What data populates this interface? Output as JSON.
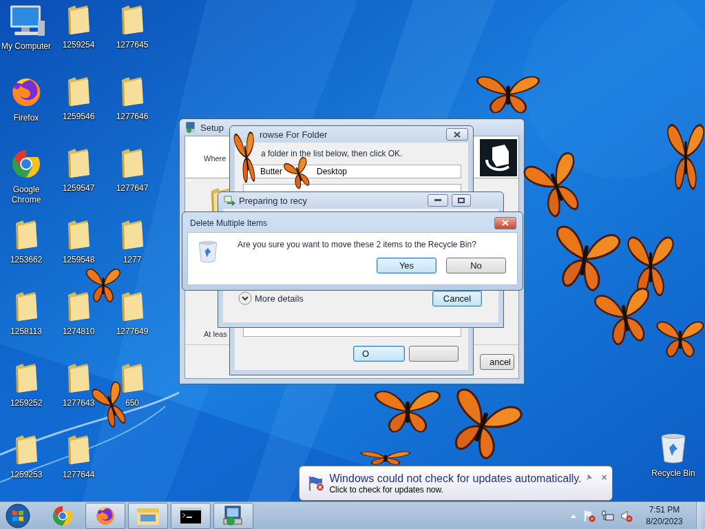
{
  "desktop_icons": [
    {
      "label": "My Computer",
      "kind": "computer"
    },
    {
      "label": "Firefox",
      "kind": "firefox"
    },
    {
      "label": "Google Chrome",
      "kind": "chrome"
    },
    {
      "label": "1253662",
      "kind": "folder"
    },
    {
      "label": "1258113",
      "kind": "folder"
    },
    {
      "label": "1259252",
      "kind": "folder"
    },
    {
      "label": "1259253",
      "kind": "folder"
    },
    {
      "label": "1259254",
      "kind": "folder"
    },
    {
      "label": "1259546",
      "kind": "folder"
    },
    {
      "label": "1259547",
      "kind": "folder"
    },
    {
      "label": "1259548",
      "kind": "folder"
    },
    {
      "label": "1274810",
      "kind": "folder"
    },
    {
      "label": "1277643",
      "kind": "folder"
    },
    {
      "label": "1277644",
      "kind": "folder"
    },
    {
      "label": "1277645",
      "kind": "folder"
    },
    {
      "label": "1277646",
      "kind": "folder"
    },
    {
      "label": "1277647",
      "kind": "folder"
    },
    {
      "label": "1277",
      "kind": "folder"
    },
    {
      "label": "1277649",
      "kind": "folder"
    },
    {
      "label": "650",
      "kind": "folder"
    }
  ],
  "recycle_bin": {
    "label": "Recycle Bin"
  },
  "setup_window": {
    "title": "Setup",
    "prompt": "Where",
    "note": "At leas",
    "button": "ancel"
  },
  "browse_window": {
    "title": "rowse For Folder",
    "instruction": "a folder in the list below, then click OK.",
    "path_start": "Butter",
    "path_end": "Desktop",
    "ok_button": "O"
  },
  "progress_window": {
    "title": "Preparing to recy",
    "details": "More details",
    "cancel": "Cancel"
  },
  "delete_dialog": {
    "title": "Delete Multiple Items",
    "message": "Are you sure you want to move these 2 items to the Recycle Bin?",
    "buttons": [
      {
        "label": "Yes",
        "selected": true
      },
      {
        "label": "No",
        "selected": false
      }
    ]
  },
  "balloon": {
    "title": "Windows could not check for updates automatically.",
    "text": "Click to check for updates now."
  },
  "taskbar": {
    "buttons": [
      {
        "kind": "chrome",
        "open": false
      },
      {
        "kind": "firefox",
        "open": true
      },
      {
        "kind": "explorer",
        "open": true
      },
      {
        "kind": "console",
        "open": true
      },
      {
        "kind": "installer",
        "open": true
      }
    ],
    "time": "7:51 PM",
    "date": "8/20/2023"
  }
}
